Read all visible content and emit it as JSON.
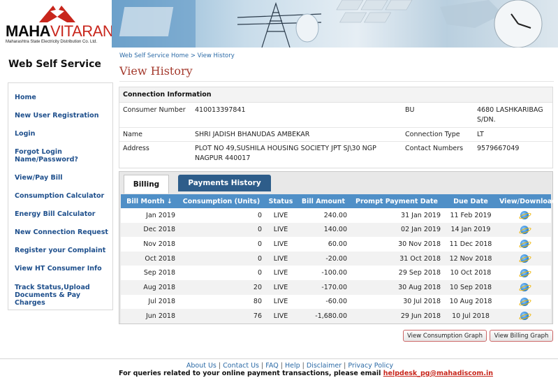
{
  "brand": {
    "name_part1": "MAHA",
    "name_part2": "VITARAN",
    "subtitle": "Maharashtra State Electricity Distribution Co. Ltd."
  },
  "app_title": "Web Self Service",
  "sidebar": {
    "items": [
      {
        "label": "Home"
      },
      {
        "label": "New User Registration"
      },
      {
        "label": "Login"
      },
      {
        "label": "Forgot Login\nName/Password?"
      },
      {
        "label": "View/Pay Bill"
      },
      {
        "label": "Consumption Calculator"
      },
      {
        "label": "Energy Bill Calculator"
      },
      {
        "label": "New Connection Request"
      },
      {
        "label": "Register your Complaint"
      },
      {
        "label": "View HT Consumer Info"
      },
      {
        "label": "Track Status,Upload\nDocuments & Pay Charges"
      }
    ]
  },
  "breadcrumb": {
    "home": "Web Self Service Home",
    "sep": ">",
    "current": "View History"
  },
  "page_title": "View History",
  "connection": {
    "heading": "Connection Information",
    "consumer_number_label": "Consumer Number",
    "consumer_number": "410013397841",
    "bu_label": "BU",
    "bu": "4680 LASHKARIBAG S/DN.",
    "name_label": "Name",
    "name": "SHRI JADISH BHANUDAS AMBEKAR",
    "connection_type_label": "Connection Type",
    "connection_type": "LT",
    "address_label": "Address",
    "address": "PLOT NO 49,SUSHILA HOUSING SOCIETY JPT SJ\\30 NGP NAGPUR 440017",
    "contact_numbers_label": "Contact Numbers",
    "contact_numbers": "9579667049"
  },
  "tabs": {
    "billing": "Billing",
    "payments": "Payments History"
  },
  "bill_table": {
    "headers": [
      "Bill Month ↓",
      "Consumption (Units)",
      "Status",
      "Bill Amount",
      "Prompt Payment Date",
      "Due Date",
      "View/Download"
    ],
    "rows": [
      {
        "month": "Jan 2019",
        "units": "0",
        "status": "LIVE",
        "amount": "240.00",
        "prompt": "31 Jan 2019",
        "due": "11 Feb 2019"
      },
      {
        "month": "Dec 2018",
        "units": "0",
        "status": "LIVE",
        "amount": "140.00",
        "prompt": "02 Jan 2019",
        "due": "14 Jan 2019"
      },
      {
        "month": "Nov 2018",
        "units": "0",
        "status": "LIVE",
        "amount": "60.00",
        "prompt": "30 Nov 2018",
        "due": "11 Dec 2018"
      },
      {
        "month": "Oct 2018",
        "units": "0",
        "status": "LIVE",
        "amount": "-20.00",
        "prompt": "31 Oct 2018",
        "due": "12 Nov 2018"
      },
      {
        "month": "Sep 2018",
        "units": "0",
        "status": "LIVE",
        "amount": "-100.00",
        "prompt": "29 Sep 2018",
        "due": "10 Oct 2018"
      },
      {
        "month": "Aug 2018",
        "units": "20",
        "status": "LIVE",
        "amount": "-170.00",
        "prompt": "30 Aug 2018",
        "due": "10 Sep 2018"
      },
      {
        "month": "Jul 2018",
        "units": "80",
        "status": "LIVE",
        "amount": "-60.00",
        "prompt": "30 Jul 2018",
        "due": "10 Aug 2018"
      },
      {
        "month": "Jun 2018",
        "units": "76",
        "status": "LIVE",
        "amount": "-1,680.00",
        "prompt": "29 Jun 2018",
        "due": "10 Jul 2018"
      }
    ],
    "download_icon": "ie-globe-icon"
  },
  "buttons": {
    "consumption_graph": "View Consumption Graph",
    "billing_graph": "View Billing Graph"
  },
  "footer": {
    "links": [
      "About Us",
      "Contact Us",
      "FAQ",
      "Help",
      "Disclaimer",
      "Privacy Policy"
    ],
    "sep": "|",
    "note": "For queries related to your online payment transactions, please email",
    "email": "helpdesk_pg@mahadiscom.in"
  },
  "colors": {
    "brand_red": "#c8261c",
    "link_blue": "#1e4f8c",
    "table_header": "#4f8fc7",
    "active_tab_dark": "#2e5d8a",
    "title_red": "#a43a2d"
  }
}
